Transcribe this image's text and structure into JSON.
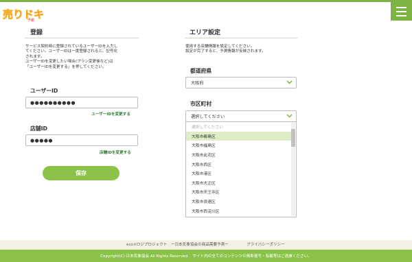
{
  "header": {
    "logo_text": "売りドキ!",
    "logo_sub": "予報",
    "menu_label": ""
  },
  "registration": {
    "title": "登録",
    "desc": "サービス契約時に登録されているユーザーIDを入力し\nてください。ユーザーIDは一度登録されると、記号化\nされます。\nユーザーIDを変更したい場合(プラン変更後など)は\n「ユーザーIDを変更する」を押してください。",
    "user_id_label": "ユーザーID",
    "user_id_value": "●●●●●●●●●●",
    "change_user_id_link": "ユーザーIDを変更する",
    "store_id_label": "店舗ID",
    "store_id_value": "●●●●●",
    "change_store_id_link": "店舗IDを変更する",
    "save_label": "保存"
  },
  "area": {
    "title": "エリア設定",
    "desc": "使用する店舗情報を設定してください。\n設定が完了すると、予測情報が反映されます。",
    "prefecture_label": "都道府県",
    "prefecture_value": "大阪府",
    "city_label": "市区町村",
    "city_value": "選択してください",
    "city_options": [
      "選択してください",
      "大阪市都島区",
      "大阪市福島区",
      "大阪市此花区",
      "大阪市西区",
      "大阪市港区",
      "大阪市大正区",
      "大阪市天王寺区",
      "大阪市浪速区",
      "大阪市西淀川区"
    ],
    "selected_option_index": 1
  },
  "footer": {
    "project_link": "eco×ロジプロジェクト　ー日本気象協会の商品需要予測ー",
    "privacy_link": "プライバシーポリシー",
    "copyright": "Copyright(C) 日本気象協会 All Rights Reserved.　サイト内の全てのコンテンツの無断複写・転載等はご遠慮ください。"
  },
  "colors": {
    "accent": "#8bc34a",
    "accent_dark": "#7cb342",
    "link": "#2e7d32",
    "selected_bg": "#dcedc8"
  }
}
